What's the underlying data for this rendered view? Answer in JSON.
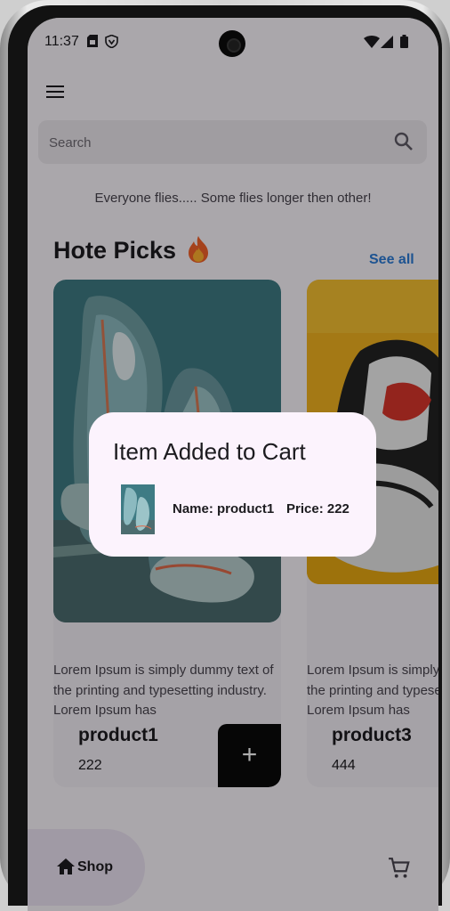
{
  "status_bar": {
    "time": "11:37",
    "icons": [
      "sim-card-icon",
      "shield-icon",
      "wifi-icon",
      "signal-icon",
      "battery-icon"
    ]
  },
  "header": {
    "menu_icon": "hamburger-menu-icon"
  },
  "search": {
    "placeholder": "Search",
    "icon": "search-icon"
  },
  "tagline": "Everyone flies..... Some flies longer then other!",
  "section": {
    "title": "Hote Picks",
    "icon": "fire-icon",
    "see_all": "See all"
  },
  "products": [
    {
      "name": "product1",
      "price": "222",
      "description": "Lorem Ipsum is simply dummy text of the printing and typesetting industry. Lorem Ipsum has",
      "add_icon": "+"
    },
    {
      "name": "product3",
      "price": "444",
      "description": "Lorem Ipsum is simply dummy text of the printing and typesetting industry. Lorem Ipsum has"
    }
  ],
  "bottom_nav": {
    "shop_label": "Shop",
    "shop_icon": "home-icon",
    "cart_icon": "shopping-cart-icon"
  },
  "dialog": {
    "title": "Item Added to Cart",
    "name_text": "Name: product1",
    "price_text": "Price: 222"
  },
  "colors": {
    "accent": "#2b7bd6",
    "dialog_bg": "#fcf3fd",
    "add_button": "#0a0a0a"
  }
}
